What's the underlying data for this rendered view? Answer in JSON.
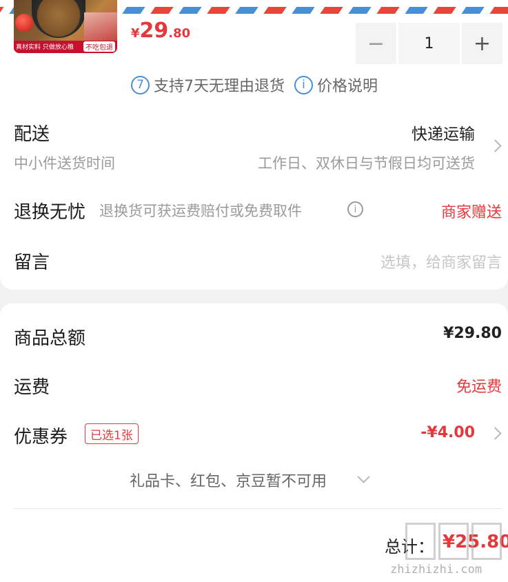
{
  "product": {
    "image_band_text": "真材实料 只做放心粮",
    "image_tag": "不吃包退",
    "price_symbol": "¥",
    "price_integer": "29",
    "price_decimal": ".80",
    "quantity": "1",
    "minus": "−",
    "plus": "+"
  },
  "services": {
    "return_badge": "7",
    "return_text": "支持7天无理由退货",
    "price_info_icon": "i",
    "price_info_text": "价格说明"
  },
  "delivery": {
    "label": "配送",
    "method": "快递运输",
    "sub_label": "中小件送货时间",
    "time": "工作日、双休日与节假日均可送货"
  },
  "exchange": {
    "label": "退换无忧",
    "description": "退换货可获运费赔付或免费取件",
    "value": "商家赠送"
  },
  "message": {
    "label": "留言",
    "placeholder": "选填，给商家留言"
  },
  "summary": {
    "goods_total_label": "商品总额",
    "goods_total_value": "¥29.80",
    "shipping_label": "运费",
    "shipping_value": "免运费",
    "coupon_label": "优惠券",
    "coupon_badge": "已选1张",
    "coupon_value": "-¥4.00",
    "unavailable_text": "礼品卡、红包、京豆暂不可用",
    "total_label": "总计：",
    "total_value": "¥25.80"
  },
  "watermark": {
    "url": "zhizhizhi.com"
  },
  "colors": {
    "accent_red": "#e4393c",
    "info_blue": "#4a8fd6"
  }
}
